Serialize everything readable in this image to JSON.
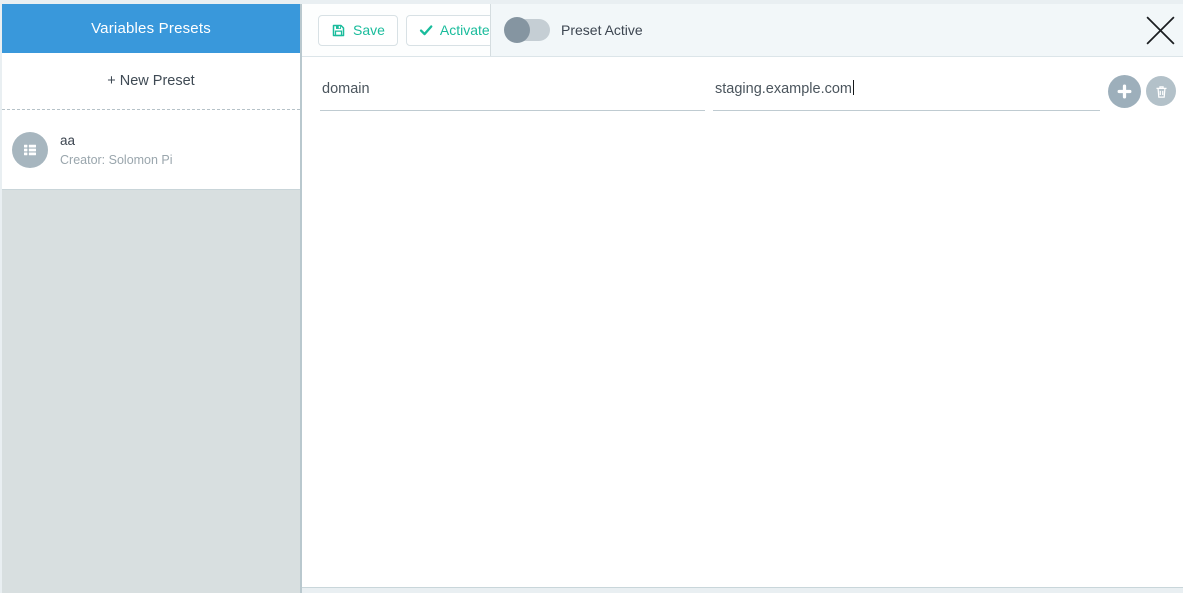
{
  "window": {
    "close_icon": "close-x-icon"
  },
  "sidebar": {
    "title": "Variables Presets",
    "new_preset_label": "+ New Preset",
    "presets": [
      {
        "name": "aa",
        "creator": "Creator: Solomon Pi",
        "icon": "list-icon"
      }
    ]
  },
  "toolbar": {
    "save_label": "Save",
    "save_icon": "floppy-disk-icon",
    "activate_label": "Activate",
    "activate_icon": "check-icon",
    "preset_active_label": "Preset Active",
    "preset_active_state": "off"
  },
  "editor": {
    "rows": [
      {
        "key": "domain",
        "value": "staging.example.com",
        "caret_after_value": true
      }
    ],
    "add_icon": "plus-icon",
    "delete_icon": "trash-icon"
  },
  "colors": {
    "header_blue": "#3998db",
    "accent_teal": "#1abc9c",
    "sidebar_empty_gray": "#d8dfe0",
    "toolbar_right_bg": "#f2f7f9",
    "page_bg": "#e9eff2",
    "circle_button_gray": "#9dafbb",
    "disabled_circle_gray": "#b3c1c9"
  }
}
